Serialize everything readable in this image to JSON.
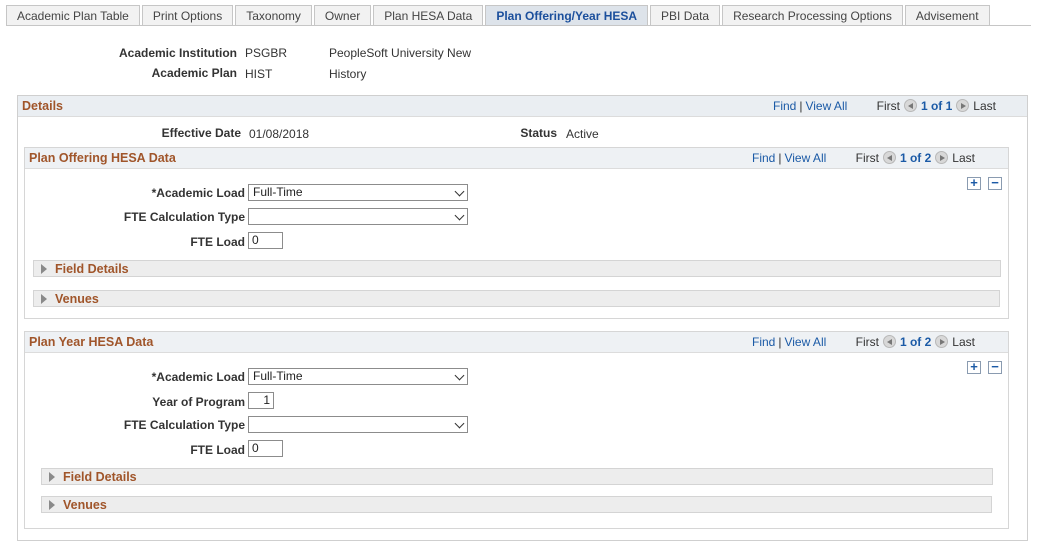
{
  "tabs": [
    {
      "label": "Academic Plan Table",
      "active": false
    },
    {
      "label": "Print Options",
      "active": false
    },
    {
      "label": "Taxonomy",
      "active": false
    },
    {
      "label": "Owner",
      "active": false
    },
    {
      "label": "Plan HESA Data",
      "active": false
    },
    {
      "label": "Plan Offering/Year HESA",
      "active": true
    },
    {
      "label": "PBI Data",
      "active": false
    },
    {
      "label": "Research Processing Options",
      "active": false
    },
    {
      "label": "Advisement",
      "active": false
    }
  ],
  "header": {
    "institution_label": "Academic Institution",
    "institution_code": "PSGBR",
    "institution_name": "PeopleSoft University New",
    "plan_label": "Academic Plan",
    "plan_code": "HIST",
    "plan_name": "History"
  },
  "details": {
    "title": "Details",
    "find": "Find",
    "view_all": "View All",
    "first": "First",
    "page": "1 of 1",
    "last": "Last",
    "effective_date_label": "Effective Date",
    "effective_date": "01/08/2018",
    "status_label": "Status",
    "status": "Active"
  },
  "offering": {
    "title": "Plan Offering HESA Data",
    "find": "Find",
    "view_all": "View All",
    "first": "First",
    "page": "1 of 2",
    "last": "Last",
    "academic_load_label": "*Academic Load",
    "academic_load": "Full-Time",
    "fte_calc_label": "FTE Calculation Type",
    "fte_calc": "",
    "fte_load_label": "FTE Load",
    "fte_load": "0",
    "field_details": "Field Details",
    "venues": "Venues"
  },
  "year": {
    "title": "Plan Year HESA Data",
    "find": "Find",
    "view_all": "View All",
    "first": "First",
    "page": "1 of 2",
    "last": "Last",
    "academic_load_label": "*Academic Load",
    "academic_load": "Full-Time",
    "year_label": "Year of Program",
    "year_value": "1",
    "fte_calc_label": "FTE Calculation Type",
    "fte_calc": "",
    "fte_load_label": "FTE Load",
    "fte_load": "0",
    "field_details": "Field Details",
    "venues": "Venues"
  },
  "icons": {
    "add": "plus-icon",
    "delete": "minus-icon",
    "prev": "prev-arrow-icon",
    "next": "next-arrow-icon",
    "expand": "expand-triangle-icon"
  }
}
